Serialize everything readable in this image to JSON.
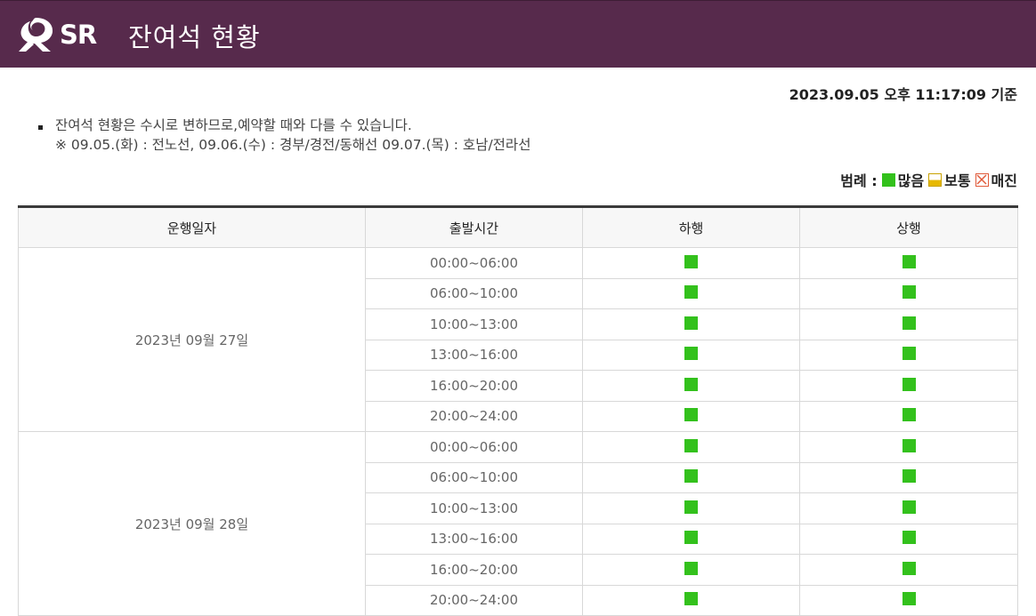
{
  "header": {
    "logo_text": "SR",
    "title": "잔여석 현황"
  },
  "timestamp": "2023.09.05 오후 11:17:09 기준",
  "notice": {
    "line1": "잔여석 현황은 수시로 변하므로,예약할 때와 다를 수 있습니다.",
    "line2": "※ 09.05.(화) : 전노선, 09.06.(수) : 경부/경전/동해선 09.07.(목) : 호남/전라선"
  },
  "legend": {
    "label": "범례 :",
    "many": "많음",
    "normal": "보통",
    "full": "매진"
  },
  "colors": {
    "header_bg": "#572a4c",
    "many": "#33c11c",
    "normal": "#e7b800",
    "full": "#e05a3a"
  },
  "table": {
    "headers": [
      "운행일자",
      "출발시간",
      "하행",
      "상행"
    ],
    "dates": [
      {
        "date": "2023년 09월 27일",
        "rows": [
          {
            "time": "00:00~06:00",
            "down": "many",
            "up": "many"
          },
          {
            "time": "06:00~10:00",
            "down": "many",
            "up": "many"
          },
          {
            "time": "10:00~13:00",
            "down": "many",
            "up": "many"
          },
          {
            "time": "13:00~16:00",
            "down": "many",
            "up": "many"
          },
          {
            "time": "16:00~20:00",
            "down": "many",
            "up": "many"
          },
          {
            "time": "20:00~24:00",
            "down": "many",
            "up": "many"
          }
        ]
      },
      {
        "date": "2023년 09월 28일",
        "rows": [
          {
            "time": "00:00~06:00",
            "down": "many",
            "up": "many"
          },
          {
            "time": "06:00~10:00",
            "down": "many",
            "up": "many"
          },
          {
            "time": "10:00~13:00",
            "down": "many",
            "up": "many"
          },
          {
            "time": "13:00~16:00",
            "down": "many",
            "up": "many"
          },
          {
            "time": "16:00~20:00",
            "down": "many",
            "up": "many"
          },
          {
            "time": "20:00~24:00",
            "down": "many",
            "up": "many"
          }
        ]
      }
    ]
  }
}
